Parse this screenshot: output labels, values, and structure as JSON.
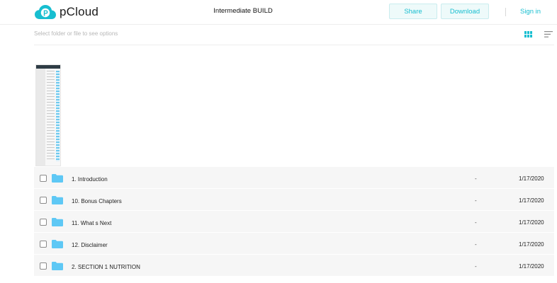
{
  "header": {
    "brand": "pCloud",
    "title": "Intermediate BUILD",
    "share_label": "Share",
    "download_label": "Download",
    "signin_label": "Sign in"
  },
  "toolbar": {
    "hint": "Select folder or file to see options",
    "view_icon": "grid-view-icon",
    "sort_icon": "sort-icon"
  },
  "colors": {
    "accent": "#17bed0",
    "folder": "#5ec8f5"
  },
  "files": [
    {
      "name": "1. Introduction",
      "size": "-",
      "date": "1/17/2020"
    },
    {
      "name": "10. Bonus Chapters",
      "size": "-",
      "date": "1/17/2020"
    },
    {
      "name": "11. What s Next",
      "size": "-",
      "date": "1/17/2020"
    },
    {
      "name": "12. Disclaimer",
      "size": "-",
      "date": "1/17/2020"
    },
    {
      "name": "2. SECTION 1 NUTRITION",
      "size": "-",
      "date": "1/17/2020"
    }
  ]
}
